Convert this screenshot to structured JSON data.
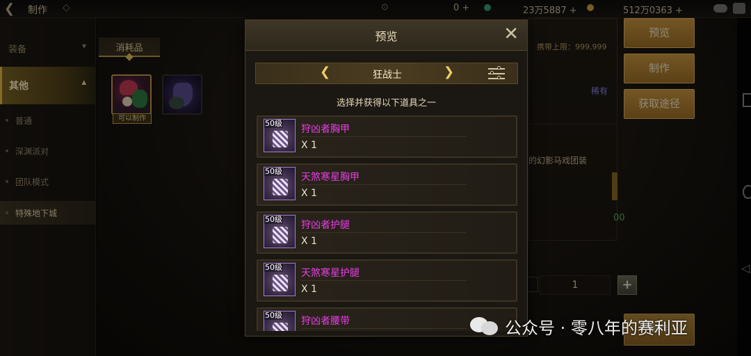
{
  "topbar": {
    "title": "制作",
    "currency_1": "0 +",
    "currency_2": "23万5887 +",
    "currency_3": "512万0363 +"
  },
  "sidebar": {
    "items": [
      {
        "label": "装备"
      },
      {
        "label": "其他"
      },
      {
        "label": "普通"
      },
      {
        "label": "深渊派对"
      },
      {
        "label": "团队模式"
      },
      {
        "label": "特殊地下城"
      }
    ]
  },
  "main": {
    "tab_label": "消耗品",
    "craftable_tag": "可以制作"
  },
  "detail": {
    "carry_limit": "携带上限：999,999",
    "rarity": "稀有",
    "desc": "的幻影马戏团装",
    "green_value": "00",
    "quantity": "1"
  },
  "buttons": {
    "preview": "预览",
    "make": "制作",
    "source": "获取途径",
    "bottom_make": "制作"
  },
  "modal": {
    "title": "预览",
    "class_name": "狂战士",
    "hint": "选择并获得以下道具之一",
    "items": [
      {
        "level": "50级",
        "name": "狩凶者胸甲",
        "qty": "X 1"
      },
      {
        "level": "50级",
        "name": "天煞寒星胸甲",
        "qty": "X 1"
      },
      {
        "level": "50级",
        "name": "狩凶者护腿",
        "qty": "X 1"
      },
      {
        "level": "50级",
        "name": "天煞寒星护腿",
        "qty": "X 1"
      },
      {
        "level": "50级",
        "name": "狩凶者腰带",
        "qty": ""
      }
    ]
  },
  "watermark": {
    "text": "公众号 · 零八年的赛利亚"
  },
  "colors": {
    "accent_gold": "#c7953f",
    "item_name": "#e83ee6",
    "rare": "#8a86e0"
  }
}
